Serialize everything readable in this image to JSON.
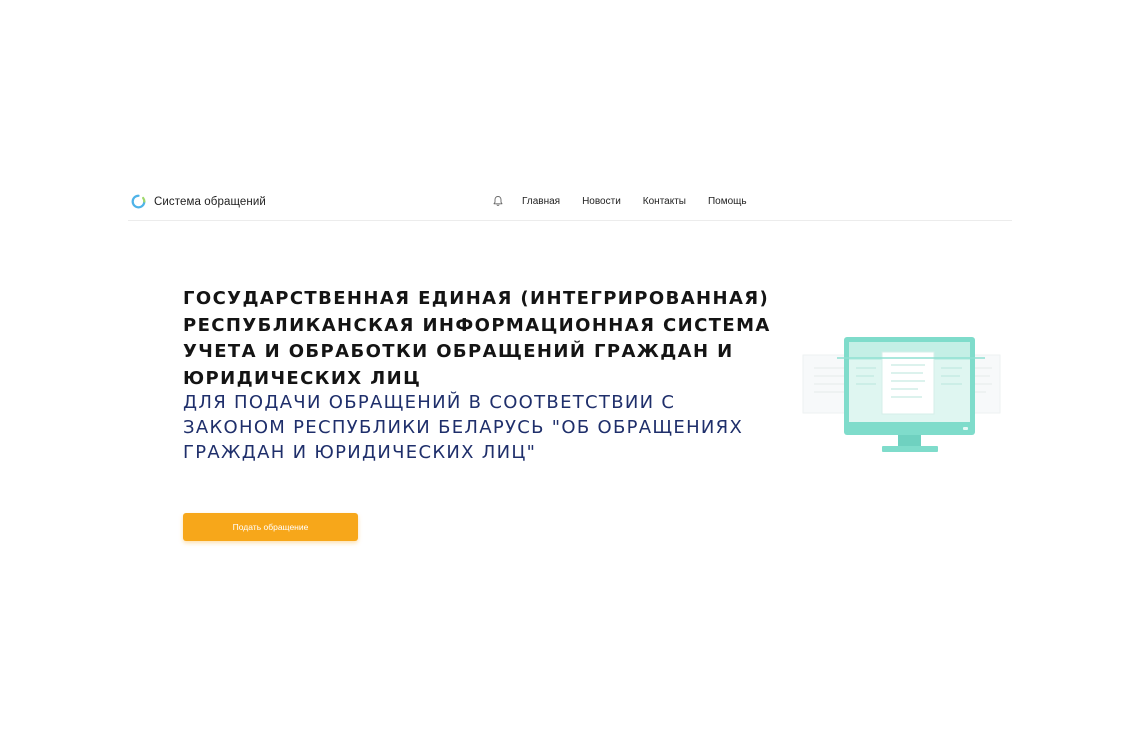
{
  "header": {
    "logo_text": "Система обращений",
    "nav": [
      {
        "label": "Главная"
      },
      {
        "label": "Новости"
      },
      {
        "label": "Контакты"
      },
      {
        "label": "Помощь"
      }
    ]
  },
  "hero": {
    "title_lines": [
      "ГОСУДАРСТВЕННАЯ ЕДИНАЯ (ИНТЕГРИРОВАННАЯ)",
      "РЕСПУБЛИКАНСКАЯ ИНФОРМАЦИОННАЯ СИСТЕМА",
      "УЧЕТА И ОБРАБОТКИ ОБРАЩЕНИЙ ГРАЖДАН И",
      "ЮРИДИЧЕСКИХ ЛИЦ"
    ],
    "subtitle_lines": [
      "ДЛЯ ПОДАЧИ ОБРАЩЕНИЙ В СООТВЕТСТВИИ С",
      "ЗАКОНОМ РЕСПУБЛИКИ БЕЛАРУСЬ \"ОБ ОБРАЩЕНИЯХ",
      "ГРАЖДАН И ЮРИДИЧЕСКИХ ЛИЦ\""
    ],
    "button_label": "Подать обращение"
  },
  "icons": {
    "logo": "logo-ring-icon",
    "notifications": "bell-icon",
    "illustration": "monitor-document-illustration"
  },
  "colors": {
    "accent_button": "#f7a71a",
    "subtitle_text": "#1f2f6b",
    "title_text": "#141414",
    "monitor": "#7fdccb",
    "logo_blue": "#4fb3e8",
    "logo_green": "#9fd86b"
  }
}
